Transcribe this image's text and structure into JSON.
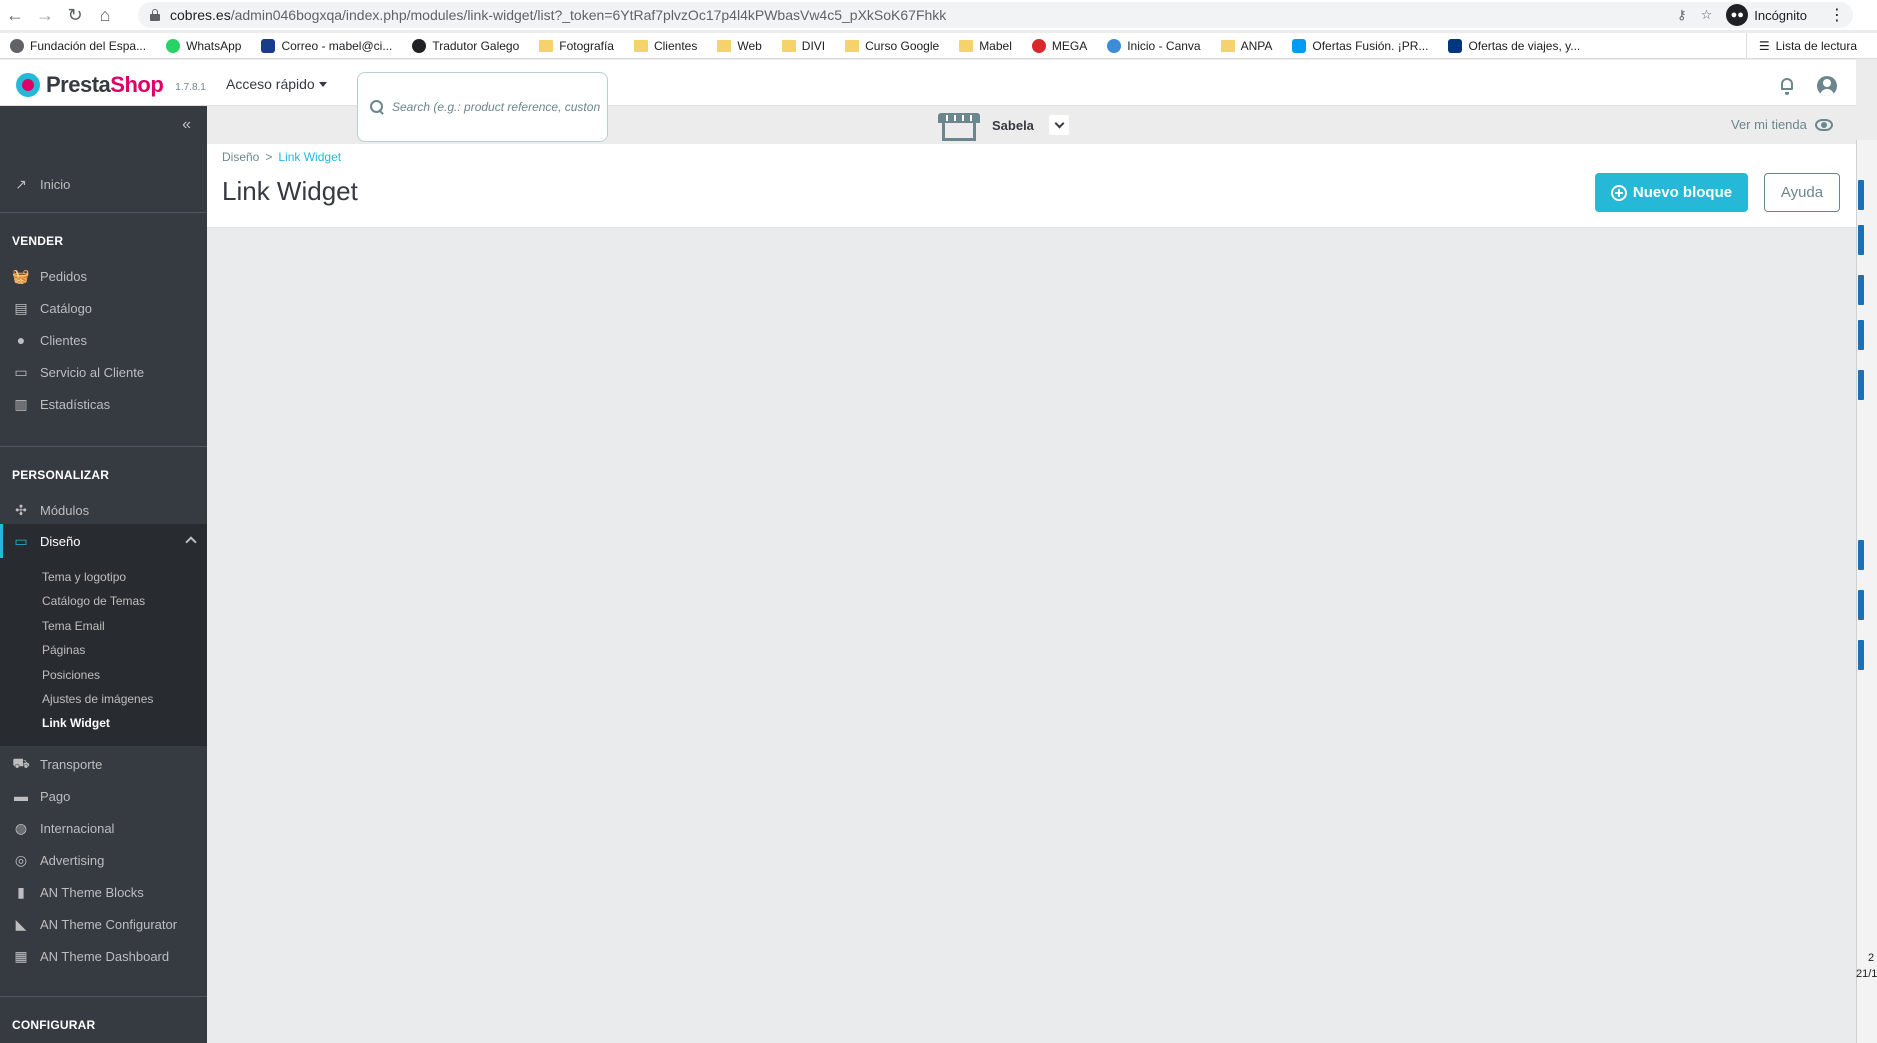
{
  "browser": {
    "url_host": "cobres.es",
    "url_path": "/admin046bogxqa/index.php/modules/link-widget/list?_token=6YtRaf7plvzOc17p4l4kPWbasVw4c5_pXkSoK67Fhkk",
    "incognito_label": "Incógnito",
    "bookmarks": [
      {
        "label": "Fundación del Espa...",
        "icon": "fundacion-icon",
        "color": "#5f6368"
      },
      {
        "label": "WhatsApp",
        "icon": "whatsapp-icon",
        "color": "#25d366"
      },
      {
        "label": "Correo - mabel@ci...",
        "icon": "outlook-icon",
        "color": "#1a3a8a"
      },
      {
        "label": "Tradutor Galego",
        "icon": "globe-icon",
        "color": "#202124"
      },
      {
        "label": "Fotografía",
        "icon": "folder-icon"
      },
      {
        "label": "Clientes",
        "icon": "folder-icon"
      },
      {
        "label": "Web",
        "icon": "folder-icon"
      },
      {
        "label": "DIVI",
        "icon": "folder-icon"
      },
      {
        "label": "Curso Google",
        "icon": "folder-icon"
      },
      {
        "label": "Mabel",
        "icon": "folder-icon"
      },
      {
        "label": "MEGA",
        "icon": "mega-icon",
        "color": "#d9272e"
      },
      {
        "label": "Inicio - Canva",
        "icon": "canva-icon",
        "color": "#3c8cd8"
      },
      {
        "label": "ANPA",
        "icon": "folder-icon"
      },
      {
        "label": "Ofertas Fusión. ¡PR...",
        "icon": "movistar-icon",
        "color": "#019df4"
      },
      {
        "label": "Ofertas de viajes, y...",
        "icon": "booking-icon",
        "color": "#003580"
      }
    ],
    "reading_list": "Lista de lectura"
  },
  "header": {
    "logo_presta": "Presta",
    "logo_shop": "Shop",
    "version": "1.7.8.1",
    "quick_access": "Acceso rápido",
    "search_placeholder": "Search (e.g.: product reference, custon"
  },
  "sidebar": {
    "inicio": "Inicio",
    "section_vender": "VENDER",
    "vender_items": [
      "Pedidos",
      "Catálogo",
      "Clientes",
      "Servicio al Cliente",
      "Estadísticas"
    ],
    "section_personalizar": "PERSONALIZAR",
    "modulos": "Módulos",
    "diseno": "Diseño",
    "diseno_sub": [
      "Tema y logotipo",
      "Catálogo de Temas",
      "Tema Email",
      "Páginas",
      "Posiciones",
      "Ajustes de imágenes",
      "Link Widget"
    ],
    "more_items": [
      "Transporte",
      "Pago",
      "Internacional",
      "Advertising",
      "AN Theme Blocks",
      "AN Theme Configurator",
      "AN Theme Dashboard"
    ],
    "section_configurar": "CONFIGURAR"
  },
  "shopbar": {
    "shop_name": "Sabela",
    "view_store": "Ver mi tienda"
  },
  "page": {
    "breadcrumb_parent": "Diseño",
    "breadcrumb_sep": ">",
    "breadcrumb_current": "Link Widget",
    "title": "Link Widget",
    "new_block_button": "Nuevo bloque",
    "help_button": "Ayuda"
  },
  "os": {
    "clock_line1": "2",
    "clock_line2": "21/1"
  },
  "colors": {
    "accent": "#25b9d7",
    "brand": "#df0067",
    "sidebar": "#363a41"
  }
}
